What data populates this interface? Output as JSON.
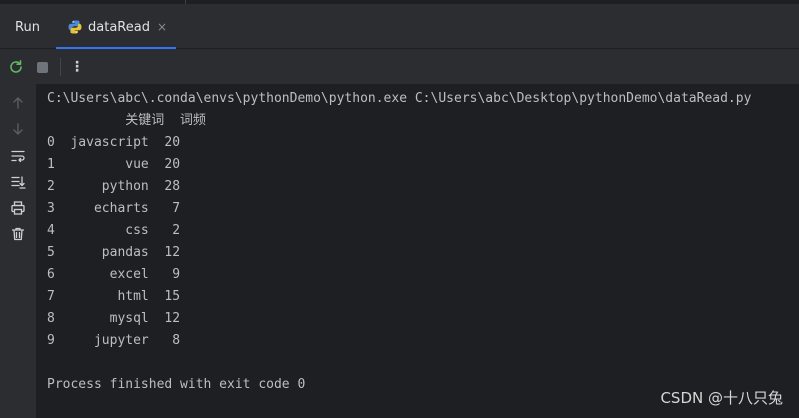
{
  "tool_window": {
    "title": "Run"
  },
  "tab": {
    "label": "dataRead",
    "close_glyph": "×",
    "icon": "python-icon"
  },
  "toolbar": {
    "more_glyph": "⋮",
    "icons": [
      "rerun-icon",
      "stop-icon",
      "more-options-icon"
    ]
  },
  "sidebar": {
    "icons": [
      "arrow-up-icon",
      "arrow-down-icon",
      "soft-wrap-icon",
      "scroll-to-end-icon",
      "print-icon",
      "trash-icon"
    ]
  },
  "console": {
    "command": "C:\\Users\\abc\\.conda\\envs\\pythonDemo\\python.exe C:\\Users\\abc\\Desktop\\pythonDemo\\dataRead.py",
    "header": "          关键词  词频",
    "rows": [
      "0  javascript  20",
      "1         vue  20",
      "2      python  28",
      "3     echarts   7",
      "4         css   2",
      "5      pandas  12",
      "6       excel   9",
      "7        html  15",
      "8       mysql  12",
      "9     jupyter   8"
    ],
    "blank": "",
    "exit_message": "Process finished with exit code 0"
  },
  "watermark": "CSDN @十八只兔",
  "colors": {
    "accent": "#3574f0",
    "console_bg": "#1e1f22",
    "panel_bg": "#2b2d30"
  }
}
